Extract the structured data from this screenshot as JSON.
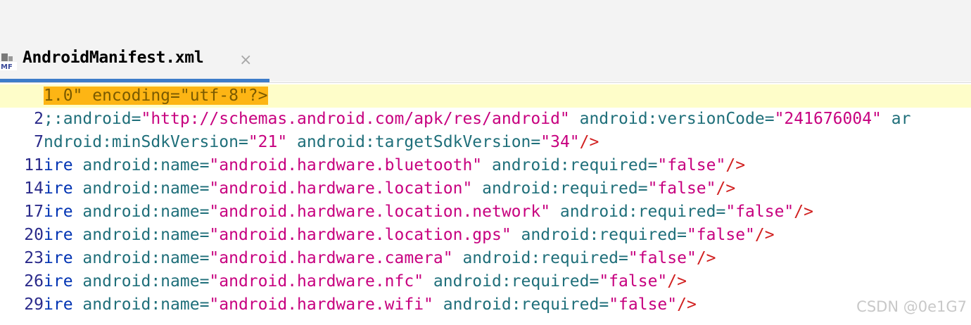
{
  "tab": {
    "icon": "android-manifest-file-icon",
    "icon_label": "MF",
    "title": "AndroidManifest.xml",
    "close_glyph": "×"
  },
  "editor": {
    "lines": [
      {
        "num": "",
        "segs": [
          {
            "c": "hl",
            "t": "1.0\" encoding=\"utf-8\"?>"
          }
        ]
      },
      {
        "num": "2",
        "segs": [
          {
            "c": "t-attr",
            "t": ";:android"
          },
          {
            "c": "t-eq",
            "t": "="
          },
          {
            "c": "t-str",
            "t": "\"http://schemas.android.com/apk/res/android\""
          },
          {
            "c": "t-attr",
            "t": " android:versionCode"
          },
          {
            "c": "t-eq",
            "t": "="
          },
          {
            "c": "t-str",
            "t": "\"241676004\""
          },
          {
            "c": "t-attr",
            "t": " ar"
          }
        ]
      },
      {
        "num": "7",
        "segs": [
          {
            "c": "t-attr",
            "t": "ndroid:minSdkVersion"
          },
          {
            "c": "t-eq",
            "t": "="
          },
          {
            "c": "t-str",
            "t": "\"21\""
          },
          {
            "c": "t-attr",
            "t": " android:targetSdkVersion"
          },
          {
            "c": "t-eq",
            "t": "="
          },
          {
            "c": "t-str",
            "t": "\"34\""
          },
          {
            "c": "t-punc",
            "t": "/>"
          }
        ]
      },
      {
        "num": "11",
        "segs": [
          {
            "c": "t-tag",
            "t": "ire"
          },
          {
            "c": "t-attr",
            "t": " android:name"
          },
          {
            "c": "t-eq",
            "t": "="
          },
          {
            "c": "t-str",
            "t": "\"android.hardware.bluetooth\""
          },
          {
            "c": "t-attr",
            "t": " android:required"
          },
          {
            "c": "t-eq",
            "t": "="
          },
          {
            "c": "t-str",
            "t": "\"false\""
          },
          {
            "c": "t-punc",
            "t": "/>"
          }
        ]
      },
      {
        "num": "14",
        "segs": [
          {
            "c": "t-tag",
            "t": "ire"
          },
          {
            "c": "t-attr",
            "t": " android:name"
          },
          {
            "c": "t-eq",
            "t": "="
          },
          {
            "c": "t-str",
            "t": "\"android.hardware.location\""
          },
          {
            "c": "t-attr",
            "t": " android:required"
          },
          {
            "c": "t-eq",
            "t": "="
          },
          {
            "c": "t-str",
            "t": "\"false\""
          },
          {
            "c": "t-punc",
            "t": "/>"
          }
        ]
      },
      {
        "num": "17",
        "segs": [
          {
            "c": "t-tag",
            "t": "ire"
          },
          {
            "c": "t-attr",
            "t": " android:name"
          },
          {
            "c": "t-eq",
            "t": "="
          },
          {
            "c": "t-str",
            "t": "\"android.hardware.location.network\""
          },
          {
            "c": "t-attr",
            "t": " android:required"
          },
          {
            "c": "t-eq",
            "t": "="
          },
          {
            "c": "t-str",
            "t": "\"false\""
          },
          {
            "c": "t-punc",
            "t": "/>"
          }
        ]
      },
      {
        "num": "20",
        "segs": [
          {
            "c": "t-tag",
            "t": "ire"
          },
          {
            "c": "t-attr",
            "t": " android:name"
          },
          {
            "c": "t-eq",
            "t": "="
          },
          {
            "c": "t-str",
            "t": "\"android.hardware.location.gps\""
          },
          {
            "c": "t-attr",
            "t": " android:required"
          },
          {
            "c": "t-eq",
            "t": "="
          },
          {
            "c": "t-str",
            "t": "\"false\""
          },
          {
            "c": "t-punc",
            "t": "/>"
          }
        ]
      },
      {
        "num": "23",
        "segs": [
          {
            "c": "t-tag",
            "t": "ire"
          },
          {
            "c": "t-attr",
            "t": " android:name"
          },
          {
            "c": "t-eq",
            "t": "="
          },
          {
            "c": "t-str",
            "t": "\"android.hardware.camera\""
          },
          {
            "c": "t-attr",
            "t": " android:required"
          },
          {
            "c": "t-eq",
            "t": "="
          },
          {
            "c": "t-str",
            "t": "\"false\""
          },
          {
            "c": "t-punc",
            "t": "/>"
          }
        ]
      },
      {
        "num": "26",
        "segs": [
          {
            "c": "t-tag",
            "t": "ire"
          },
          {
            "c": "t-attr",
            "t": " android:name"
          },
          {
            "c": "t-eq",
            "t": "="
          },
          {
            "c": "t-str",
            "t": "\"android.hardware.nfc\""
          },
          {
            "c": "t-attr",
            "t": " android:required"
          },
          {
            "c": "t-eq",
            "t": "="
          },
          {
            "c": "t-str",
            "t": "\"false\""
          },
          {
            "c": "t-punc",
            "t": "/>"
          }
        ]
      },
      {
        "num": "29",
        "segs": [
          {
            "c": "t-tag",
            "t": "ire"
          },
          {
            "c": "t-attr",
            "t": " android:name"
          },
          {
            "c": "t-eq",
            "t": "="
          },
          {
            "c": "t-str",
            "t": "\"android.hardware.wifi\""
          },
          {
            "c": "t-attr",
            "t": " android:required"
          },
          {
            "c": "t-eq",
            "t": "="
          },
          {
            "c": "t-str",
            "t": "\"false\""
          },
          {
            "c": "t-punc",
            "t": "/>"
          }
        ]
      }
    ]
  },
  "watermark": "CSDN @0e1G7",
  "colors": {
    "highlight": "#fdb514",
    "current_line": "#fefdc9",
    "tab_underline": "#3d7cc9",
    "string": "#c7007f",
    "attribute": "#1f6f7a",
    "line_number": "#2a2a8a",
    "punctuation": "#d12020"
  }
}
